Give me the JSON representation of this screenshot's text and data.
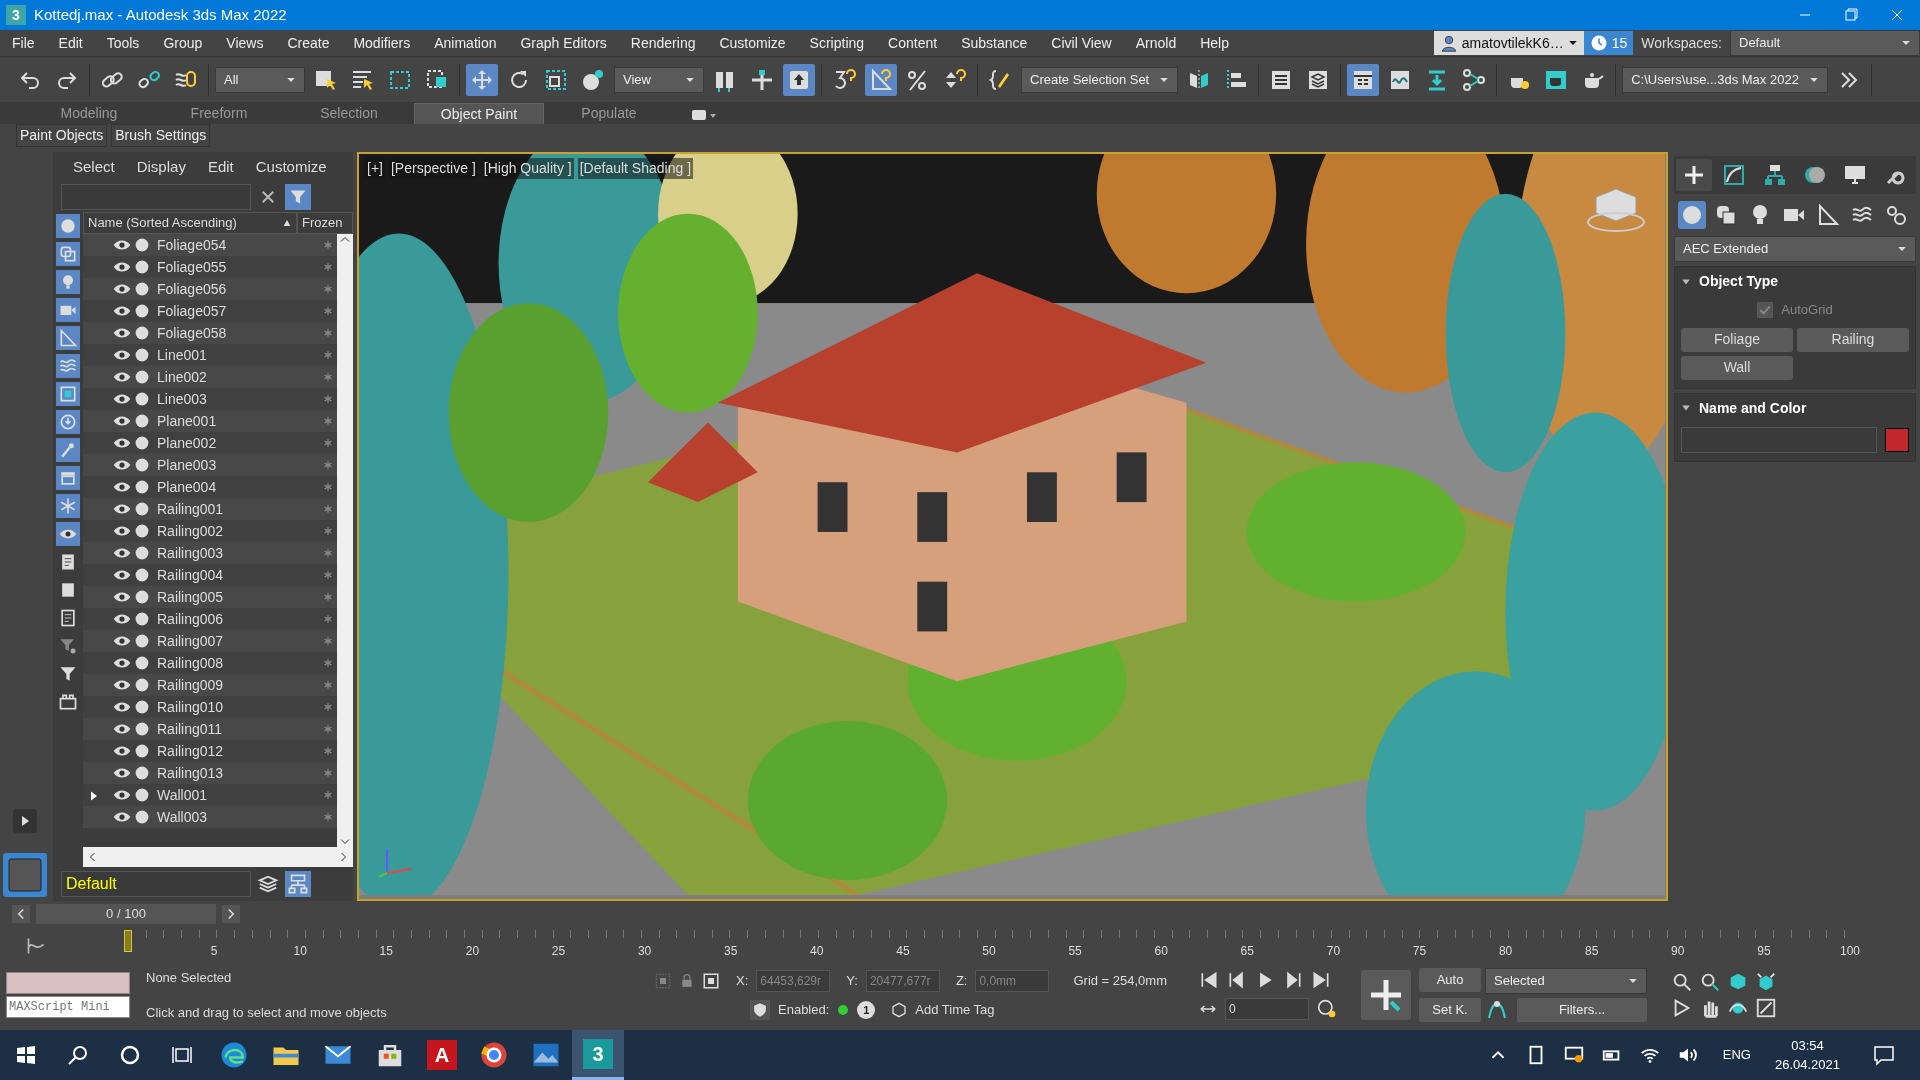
{
  "window": {
    "logo": "3",
    "title": "Kottedj.max - Autodesk 3ds Max 2022"
  },
  "menu": [
    "File",
    "Edit",
    "Tools",
    "Group",
    "Views",
    "Create",
    "Modifiers",
    "Animation",
    "Graph Editors",
    "Rendering",
    "Customize",
    "Scripting",
    "Content",
    "Substance",
    "Civil View",
    "Arnold",
    "Help"
  ],
  "account": {
    "user": "amatovtilekK6…",
    "notifications": "15",
    "workspaces_label": "Workspaces:",
    "workspace": "Default"
  },
  "toolbar": [
    [
      {
        "kind": "icon",
        "selected": false
      },
      {
        "kind": "icon",
        "selected": false
      }
    ],
    [
      {
        "kind": "icon",
        "selected": false
      },
      {
        "kind": "icon",
        "selected": false
      },
      {
        "kind": "icon",
        "selected": false
      }
    ],
    [
      {
        "kind": "dropdown",
        "value": "All"
      },
      {
        "kind": "icon",
        "selected": false
      },
      {
        "kind": "icon",
        "selected": false
      },
      {
        "kind": "icon",
        "selected": false
      },
      {
        "kind": "icon",
        "selected": false
      }
    ],
    [
      {
        "kind": "icon",
        "selected": true
      },
      {
        "kind": "icon",
        "selected": false
      },
      {
        "kind": "icon",
        "selected": false
      },
      {
        "kind": "icon",
        "selected": false
      },
      {
        "kind": "dropdown",
        "value": "View"
      },
      {
        "kind": "icon",
        "selected": false
      },
      {
        "kind": "icon",
        "selected": false
      },
      {
        "kind": "icon",
        "selected": true
      }
    ],
    [
      {
        "kind": "icon",
        "selected": false
      },
      {
        "kind": "icon",
        "selected": true
      },
      {
        "kind": "icon",
        "selected": false
      },
      {
        "kind": "icon",
        "selected": false
      }
    ],
    [
      {
        "kind": "icon",
        "selected": false
      },
      {
        "kind": "dropdown",
        "value": "Create Selection Set"
      },
      {
        "kind": "icon",
        "selected": false
      },
      {
        "kind": "icon",
        "selected": false
      }
    ],
    [
      {
        "kind": "icon",
        "selected": false
      },
      {
        "kind": "icon",
        "selected": false
      }
    ],
    [
      {
        "kind": "icon",
        "selected": true
      },
      {
        "kind": "icon",
        "selected": false
      },
      {
        "kind": "icon",
        "selected": false
      },
      {
        "kind": "icon",
        "selected": false
      }
    ],
    [
      {
        "kind": "icon",
        "selected": false
      },
      {
        "kind": "icon",
        "selected": false
      },
      {
        "kind": "icon",
        "selected": false
      }
    ],
    [
      {
        "kind": "dropdown",
        "value": "C:\\Users\\use...3ds Max 2022"
      },
      {
        "kind": "icon",
        "selected": false
      }
    ]
  ],
  "ribbon": {
    "tabs": [
      {
        "label": "Modeling",
        "selected": false
      },
      {
        "label": "Freeform",
        "selected": false
      },
      {
        "label": "Selection",
        "selected": false
      },
      {
        "label": "Object Paint",
        "selected": true
      },
      {
        "label": "Populate",
        "selected": false
      }
    ],
    "panels": [
      "Paint Objects",
      "Brush Settings"
    ]
  },
  "scene_explorer": {
    "menu": [
      "Select",
      "Display",
      "Edit",
      "Customize"
    ],
    "columns": [
      "Name (Sorted Ascending)",
      "Frozen"
    ],
    "filters": [
      {
        "selected": true
      },
      {
        "selected": true
      },
      {
        "selected": true
      },
      {
        "selected": true
      },
      {
        "selected": true
      },
      {
        "selected": true
      },
      {
        "selected": true
      },
      {
        "selected": true
      },
      {
        "selected": true
      },
      {
        "selected": true
      },
      {
        "selected": true
      },
      {
        "selected": true
      },
      {
        "selected": false
      },
      {
        "selected": false
      },
      {
        "selected": false
      },
      {
        "selected": false
      },
      {
        "selected": false
      },
      {
        "selected": false
      }
    ],
    "rows": [
      {
        "name": "Foliage054",
        "has_children": false
      },
      {
        "name": "Foliage055",
        "has_children": false
      },
      {
        "name": "Foliage056",
        "has_children": false
      },
      {
        "name": "Foliage057",
        "has_children": false
      },
      {
        "name": "Foliage058",
        "has_children": false
      },
      {
        "name": "Line001",
        "has_children": false
      },
      {
        "name": "Line002",
        "has_children": false
      },
      {
        "name": "Line003",
        "has_children": false
      },
      {
        "name": "Plane001",
        "has_children": false
      },
      {
        "name": "Plane002",
        "has_children": false
      },
      {
        "name": "Plane003",
        "has_children": false
      },
      {
        "name": "Plane004",
        "has_children": false
      },
      {
        "name": "Railing001",
        "has_children": false
      },
      {
        "name": "Railing002",
        "has_children": false
      },
      {
        "name": "Railing003",
        "has_children": false
      },
      {
        "name": "Railing004",
        "has_children": false
      },
      {
        "name": "Railing005",
        "has_children": false
      },
      {
        "name": "Railing006",
        "has_children": false
      },
      {
        "name": "Railing007",
        "has_children": false
      },
      {
        "name": "Railing008",
        "has_children": false
      },
      {
        "name": "Railing009",
        "has_children": false
      },
      {
        "name": "Railing010",
        "has_children": false
      },
      {
        "name": "Railing011",
        "has_children": false
      },
      {
        "name": "Railing012",
        "has_children": false
      },
      {
        "name": "Railing013",
        "has_children": false
      },
      {
        "name": "Wall001",
        "has_children": true
      },
      {
        "name": "Wall003",
        "has_children": false
      }
    ],
    "layer": "Default"
  },
  "viewport": {
    "labels": [
      "[+]",
      "[Perspective ]",
      "[High Quality ]",
      "[Default Shading ]"
    ]
  },
  "command_panel": {
    "tabs": [
      {
        "selected": true
      },
      {
        "selected": false
      },
      {
        "selected": false
      },
      {
        "selected": false
      },
      {
        "selected": false
      },
      {
        "selected": false
      }
    ],
    "categories": [
      {
        "selected": true
      },
      {
        "selected": false
      },
      {
        "selected": false
      },
      {
        "selected": false
      },
      {
        "selected": false
      },
      {
        "selected": false
      },
      {
        "selected": false
      }
    ],
    "category_list": "AEC Extended",
    "object_type": {
      "title": "Object Type",
      "autogrid": {
        "label": "AutoGrid",
        "checked": true,
        "disabled": true
      },
      "buttons": [
        "Foliage",
        "Railing",
        "Wall"
      ]
    },
    "name_and_color": {
      "title": "Name and Color",
      "color": "#c1272d"
    }
  },
  "timeline": {
    "frame": "0 / 100",
    "level": 0,
    "ticks": [
      "5",
      "10",
      "15",
      "20",
      "25",
      "30",
      "35",
      "40",
      "45",
      "50",
      "55",
      "60",
      "65",
      "70",
      "75",
      "80",
      "85",
      "90",
      "95",
      "100"
    ]
  },
  "status": {
    "listener_placeholder": "MAXScript Mini",
    "selection": "None Selected",
    "prompt": "Click and drag to select and move objects",
    "x_label": "X:",
    "x": "64453,629r",
    "y_label": "Y:",
    "y": "20477,677r",
    "z_label": "Z:",
    "z": "0,0mm",
    "grid": "Grid = 254,0mm",
    "enabled_label": "Enabled:",
    "time_tag_count": "1",
    "add_time_tag": "Add Time Tag",
    "current_frame": "0",
    "auto_key": "Auto",
    "key_filter": "Selected",
    "set_key": "Set K.",
    "filters": "Filters..."
  },
  "taskbar": {
    "apps": [
      {
        "selected": false
      },
      {
        "selected": false
      },
      {
        "selected": false
      },
      {
        "selected": false
      },
      {
        "glyph": "A",
        "selected": false
      },
      {
        "selected": false
      },
      {
        "selected": false
      },
      {
        "glyph": "3",
        "selected": true
      }
    ],
    "language": "ENG",
    "time": "03:54",
    "date": "26.04.2021"
  }
}
